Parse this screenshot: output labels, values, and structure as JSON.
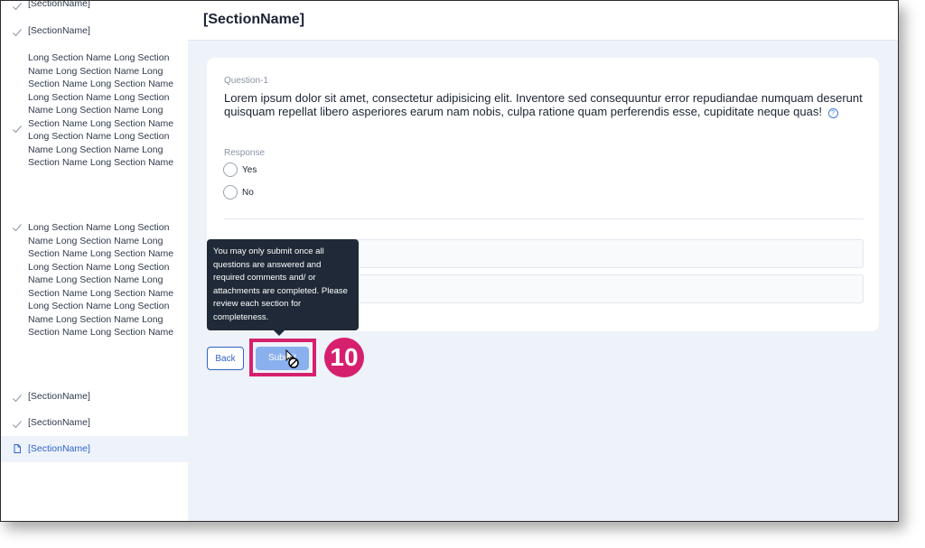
{
  "page_title": "[SectionName]",
  "sidebar": {
    "items": [
      {
        "label": "[SectionName]",
        "status": "complete"
      },
      {
        "label": "[SectionName]",
        "status": "complete"
      },
      {
        "label": "Long Section Name Long Section Name Long Section Name Long Section Name Long Section Name Long Section Name Long Section Name Long Section Name Long Section Name Long Section Name Long Section Name Long Section Name Long Section Name Long Section Name Long Section Name",
        "status": "complete"
      },
      {
        "label": "Long Section Name Long Section Name Long Section Name Long Section Name Long Section Name Long Section Name Long Section Name Long Section Name Long Section Name Long Section Name Long Section Name Long Section Name Long Section Name Long Section Name Long Section Name",
        "status": "complete"
      },
      {
        "label": "[SectionName]",
        "status": "complete"
      },
      {
        "label": "[SectionName]",
        "status": "complete"
      },
      {
        "label": "[SectionName]",
        "status": "current"
      }
    ]
  },
  "question": {
    "label": "Question-1",
    "text": "Lorem ipsum dolor sit amet, consectetur adipisicing elit. Inventore sed consequuntur error repudiandae numquam deserunt quisquam repellat libero asperiores earum nam nobis, culpa ratione quam perferendis esse, cupiditate neque quas!",
    "help_icon": "?",
    "response_label": "Response",
    "options": [
      "Yes",
      "No"
    ]
  },
  "tooltip": {
    "text": "You may only submit once all questions are answered and required comments and/ or attachments are completed. Please review each section for completeness."
  },
  "buttons": {
    "back": "Back",
    "submit": "Submit"
  },
  "annotation": {
    "step_number": "10",
    "color": "#d6206e"
  },
  "colors": {
    "accent": "#2f63c9",
    "background": "#eef2f9",
    "tooltip_bg": "#1f2937"
  }
}
